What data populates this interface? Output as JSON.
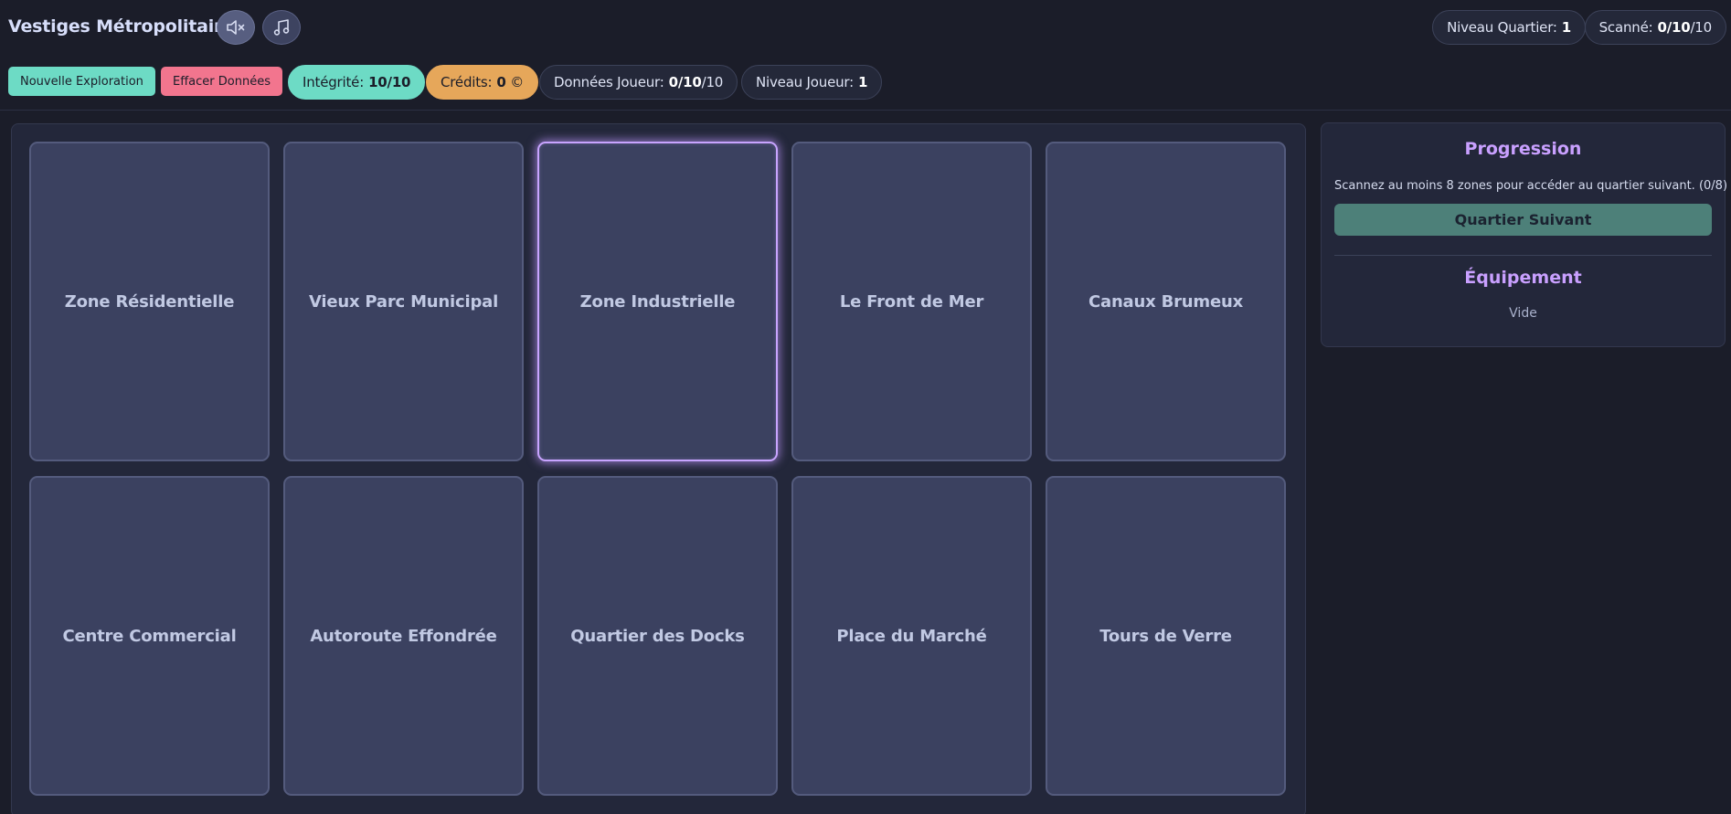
{
  "header": {
    "title": "Vestiges Métropolitains",
    "mute_icon": "speaker-muted-icon",
    "music_icon": "music-note-icon",
    "niveau_quartier": {
      "label": "Niveau Quartier:",
      "value": "1"
    },
    "scanne": {
      "label": "Scanné:",
      "value": "0/10",
      "suffix": "/10"
    }
  },
  "toolbar": {
    "new_exploration": "Nouvelle Exploration",
    "clear_data": "Effacer Données",
    "integrite": {
      "label": "Intégrité:",
      "value": "10/10"
    },
    "credits": {
      "label": "Crédits:",
      "value": "0",
      "suffix": " ©"
    },
    "donnees_joueur": {
      "label": "Données Joueur:",
      "value": "0/10",
      "suffix": "/10"
    },
    "niveau_joueur": {
      "label": "Niveau Joueur:",
      "value": "1"
    }
  },
  "zones": [
    {
      "label": "Zone Résidentielle",
      "selected": false
    },
    {
      "label": "Vieux Parc Municipal",
      "selected": false
    },
    {
      "label": "Zone Industrielle",
      "selected": true
    },
    {
      "label": "Le Front de Mer",
      "selected": false
    },
    {
      "label": "Canaux Brumeux",
      "selected": false
    },
    {
      "label": "Centre Commercial",
      "selected": false
    },
    {
      "label": "Autoroute Effondrée",
      "selected": false
    },
    {
      "label": "Quartier des Docks",
      "selected": false
    },
    {
      "label": "Place du Marché",
      "selected": false
    },
    {
      "label": "Tours de Verre",
      "selected": false
    }
  ],
  "panel": {
    "progression_title": "Progression",
    "progression_text": "Scannez au moins 8 zones pour accéder au quartier suivant. (0/8)",
    "next_button": "Quartier Suivant",
    "equipment_title": "Équipement",
    "equipment_text": "Vide"
  },
  "colors": {
    "background": "#1b1d29",
    "accent_teal": "#6ddbc5",
    "accent_pink": "#f2758e",
    "accent_orange": "#e6a75a",
    "accent_purple": "#c9a0ff",
    "card": "#3b4160"
  }
}
